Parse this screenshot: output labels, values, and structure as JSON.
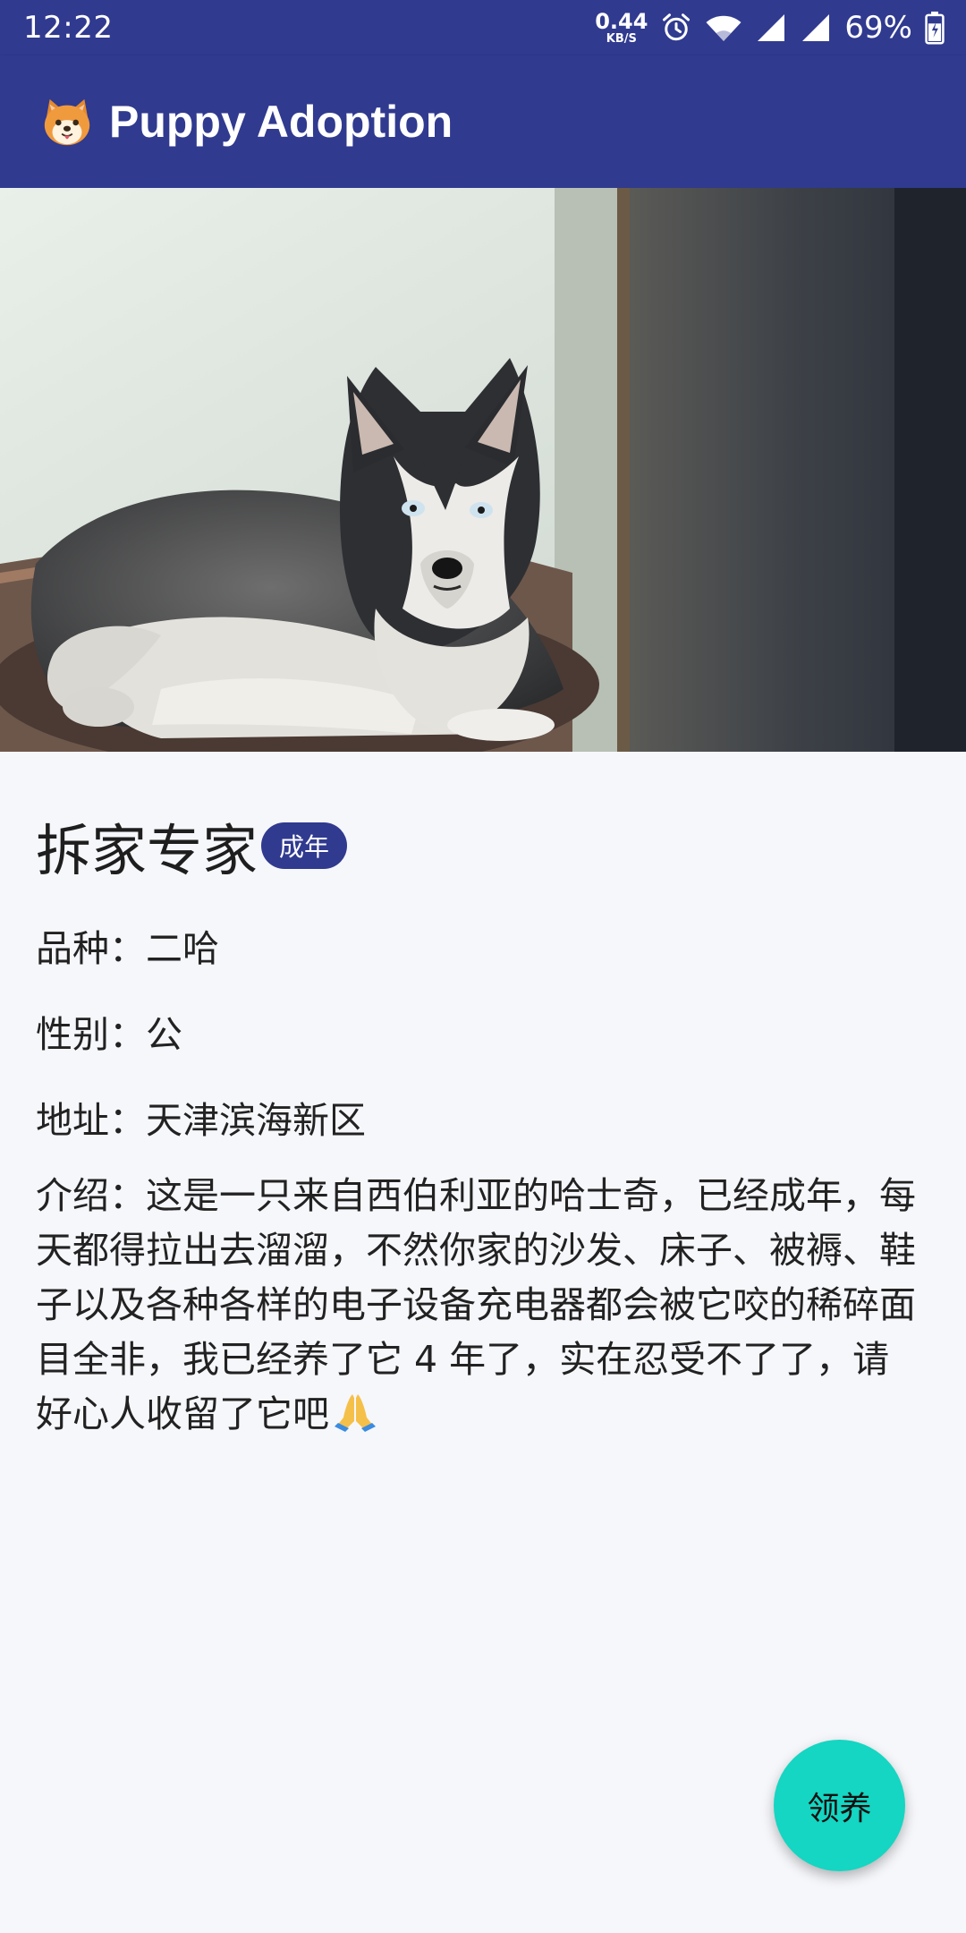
{
  "status_bar": {
    "time": "12:22",
    "net_speed_value": "0.44",
    "net_speed_unit": "KB/S",
    "battery_percent": "69%",
    "icons": [
      "alarm-icon",
      "wifi-icon",
      "signal-icon",
      "signal-icon",
      "battery-icon"
    ]
  },
  "app_bar": {
    "title": "Puppy Adoption",
    "logo_icon": "shiba-face-icon",
    "background_color": "#303a8f"
  },
  "hero": {
    "subject": "husky-photo"
  },
  "dog": {
    "name": "拆家专家",
    "age_badge": "成年",
    "breed_line": "品种：二哈",
    "gender_line": "性别：公",
    "address_line": "地址：天津滨海新区",
    "intro_text": "介绍：这是一只来自西伯利亚的哈士奇，已经成年，每天都得拉出去溜溜，不然你家的沙发、床子、被褥、鞋子以及各种各样的电子设备充电器都会被它咬的稀碎面目全非，我已经养了它 4 年了，实在忍受不了了，请好心人收留了它吧",
    "intro_emoji_icon": "folded-hands-icon"
  },
  "fab": {
    "label": "领养",
    "color": "#14d6c2"
  }
}
